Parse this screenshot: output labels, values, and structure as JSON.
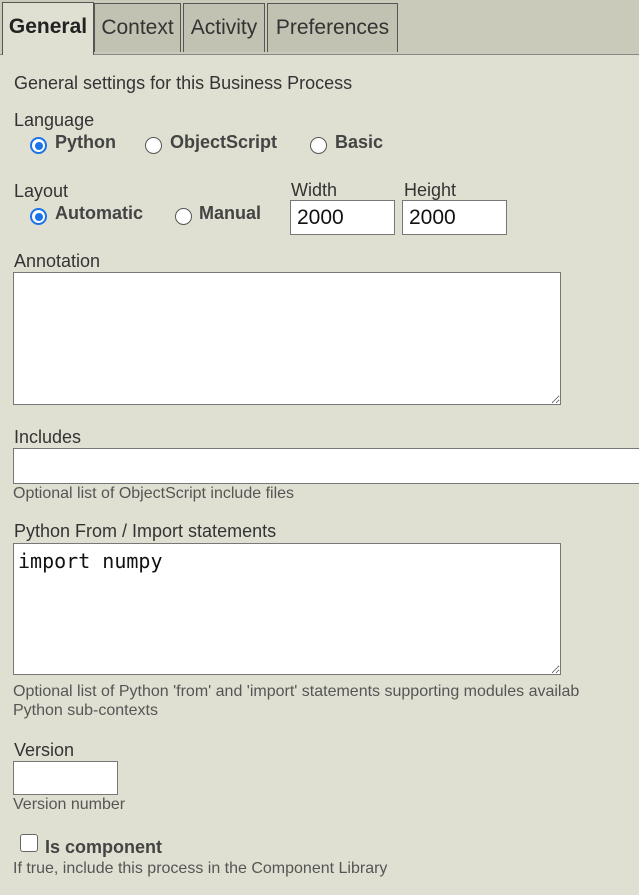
{
  "tabs": [
    {
      "label": "General",
      "active": true
    },
    {
      "label": "Context",
      "active": false
    },
    {
      "label": "Activity",
      "active": false
    },
    {
      "label": "Preferences",
      "active": false
    }
  ],
  "general": {
    "description": "General settings for this Business Process",
    "language": {
      "label": "Language",
      "options": [
        "Python",
        "ObjectScript",
        "Basic"
      ],
      "selected": "Python"
    },
    "layout": {
      "label": "Layout",
      "options": [
        "Automatic",
        "Manual"
      ],
      "selected": "Automatic"
    },
    "width": {
      "label": "Width",
      "value": "2000"
    },
    "height": {
      "label": "Height",
      "value": "2000"
    },
    "annotation": {
      "label": "Annotation",
      "value": ""
    },
    "includes": {
      "label": "Includes",
      "value": "",
      "hint": "Optional list of ObjectScript include files"
    },
    "python_imports": {
      "label": "Python From / Import statements",
      "value": "import numpy",
      "hint_line1": "Optional list of Python 'from' and 'import' statements supporting modules availab",
      "hint_line2": "Python sub-contexts"
    },
    "version": {
      "label": "Version",
      "value": "",
      "hint": "Version number"
    },
    "is_component": {
      "label": "Is component",
      "checked": false,
      "hint": "If true, include this process in the Component Library"
    }
  }
}
